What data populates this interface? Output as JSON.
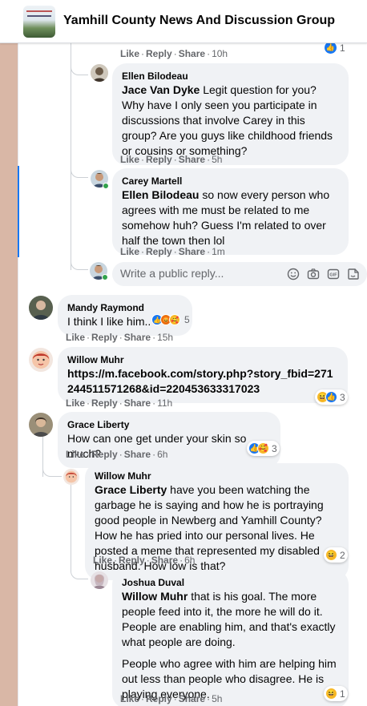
{
  "header": {
    "group_title": "Yamhill County News And Discussion Group"
  },
  "action_labels": {
    "like": "Like",
    "reply": "Reply",
    "share": "Share"
  },
  "top_actions": {
    "time": "10h",
    "reaction_count": "1"
  },
  "comments": [
    {
      "author": "Ellen Bilodeau",
      "tag": "Jace Van Dyke",
      "text": "Legit question for you? Why have I only seen you participate in discussions that involve Carey in this group? Are you guys like childhood friends or cousins or something?",
      "time": "5h"
    },
    {
      "author": "Carey Martell",
      "tag": "Ellen Bilodeau",
      "text": "so now every person who agrees with me must be related to me somehow huh? Guess I'm related to over half the town then lol",
      "time": "1m"
    },
    {
      "author": "Mandy Raymond",
      "text": "I think I like him..",
      "time": "15h",
      "reaction_count": "5"
    },
    {
      "author": "Willow Muhr",
      "link": "https://m.facebook.com/story.php?story_fbid=271244511571268&id=220453633317023",
      "time": "11h",
      "reaction_count": "3"
    },
    {
      "author": "Grace Liberty",
      "text": "How can one get under your skin so much?",
      "time": "6h",
      "reaction_count": "3"
    },
    {
      "author": "Willow Muhr",
      "tag": "Grace Liberty",
      "text": "have you been watching the garbage he is saying and how he is portraying good people in Newberg and Yamhill County? How he has pried into our personal lives. He posted a meme that represented my disabled husband. How low is that?",
      "time": "6h",
      "reaction_count": "2"
    },
    {
      "author": "Joshua Duval",
      "tag": "Willow Muhr",
      "text": "that is his goal. The more people feed into it, the more he will do it. People are enabling him, and that's exactly what people are doing.",
      "text2": "People who agree with him are helping him out less than people who disagree. He is playing everyone.",
      "time": "5h",
      "reaction_count": "1"
    }
  ],
  "reply_box": {
    "placeholder": "Write a public reply..."
  },
  "icons": [
    "emoji-icon",
    "camera-icon",
    "gif-icon",
    "sticker-icon"
  ],
  "colors": {
    "like_blue": "#1877f2",
    "haha_yellow": "#f7b928",
    "bubble": "#f0f2f5",
    "meta_gray": "#65676b"
  }
}
